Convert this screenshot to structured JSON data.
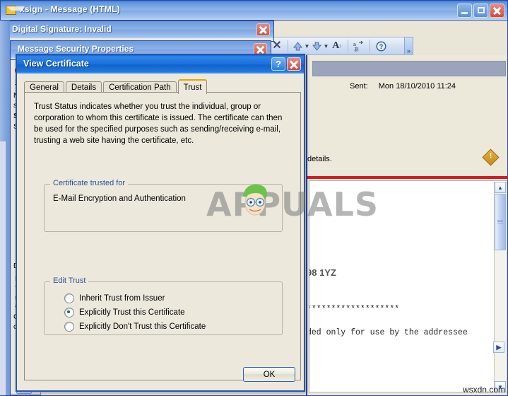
{
  "message_window": {
    "title": "xsign - Message (HTML)",
    "icon": "envelope-icon",
    "buttons": {
      "minimize": "Minimize",
      "maximize": "Maximize",
      "close": "Close"
    }
  },
  "toolbar": {
    "items": [
      {
        "name": "delete-icon",
        "glyph": "✕"
      },
      {
        "name": "previous-item-icon",
        "glyph": "▲"
      },
      {
        "name": "previous-item-dropdown-icon",
        "glyph": "▼"
      },
      {
        "name": "next-item-icon",
        "glyph": "▼"
      },
      {
        "name": "next-item-dropdown-icon",
        "glyph": "▼"
      },
      {
        "name": "font-size-icon",
        "glyph": "A"
      },
      {
        "name": "translate-icon",
        "glyph": "あ"
      },
      {
        "name": "help-icon",
        "glyph": "?"
      }
    ],
    "overflow": "»"
  },
  "behind_dialogs": [
    {
      "title": "Digital Signature: Invalid",
      "close_label": "Close"
    },
    {
      "title": "Message Security Properties",
      "close_label": "Close"
    }
  ],
  "msp_sliver": {
    "lines": [
      "M",
      "si",
      "S",
      "S",
      "D",
      "B",
      "T",
      "s",
      "a",
      "C",
      "ch"
    ],
    "scroll_left": "‹"
  },
  "view_certificate": {
    "title": "View Certificate",
    "help_label": "?",
    "close_label": "Close",
    "tabs": [
      {
        "label": "General",
        "active": false
      },
      {
        "label": "Details",
        "active": false
      },
      {
        "label": "Certification Path",
        "active": false
      },
      {
        "label": "Trust",
        "active": true
      }
    ],
    "intro_text": "Trust Status indicates whether you trust the individual, group or corporation to whom this certificate is issued.  The certificate can then be used for the specified purposes such as sending/receiving e-mail, trusting a web site having the certificate, etc.",
    "trusted_group": {
      "legend": "Certificate trusted for",
      "value": "E-Mail Encryption and Authentication"
    },
    "edit_trust_group": {
      "legend": "Edit Trust",
      "options": [
        {
          "label": "Inherit Trust from Issuer",
          "selected": false
        },
        {
          "label": "Explicitly Trust this Certificate",
          "selected": true
        },
        {
          "label": "Explicitly Don't Trust this Certificate",
          "selected": false
        }
      ]
    },
    "ok_button": "OK"
  },
  "message_body": {
    "sent_label": "Sent:",
    "sent_value": "Mon 18/10/2010 11:24",
    "details_text": "details.",
    "warning_icon": "warning-diamond-icon",
    "lines": [
      "98 1YZ",
      "*******************",
      "ded only for use by the addressee"
    ],
    "scrollbar": {
      "up": "▲",
      "down": "▼",
      "right": "▶"
    }
  },
  "watermark": {
    "text": "APPUALS",
    "source": "wsxdn.com"
  },
  "colors": {
    "titlebar_blue": "#1a6fdc",
    "dialog_face": "#ece9dc",
    "active_tab_accent": "#e8a300",
    "radio_selected": "#1e7a2c",
    "warning_rule_red": "#d81920",
    "header_gray": "#9aa4ba"
  }
}
